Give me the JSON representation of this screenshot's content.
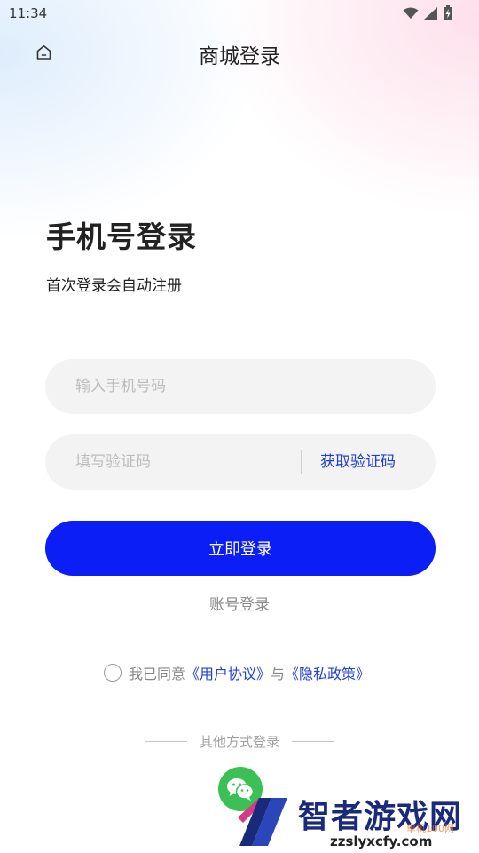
{
  "status_bar": {
    "time": "11:34",
    "icons": [
      "wifi-icon",
      "signal-icon",
      "battery-icon"
    ]
  },
  "header": {
    "title": "商城登录",
    "home_icon": "home-icon"
  },
  "login": {
    "title": "手机号登录",
    "subtitle": "首次登录会自动注册",
    "phone_placeholder": "输入手机号码",
    "code_placeholder": "填写验证码",
    "get_code_label": "获取验证码",
    "submit_label": "立即登录",
    "account_login_label": "账号登录"
  },
  "agreement": {
    "prefix": "我已同意",
    "user_agreement": "《用户协议》",
    "conjunction": "与",
    "privacy_policy": "《隐私政策》"
  },
  "other_login": {
    "label": "其他方式登录",
    "methods": [
      "wechat-icon"
    ]
  },
  "watermark": {
    "brand": "智者游戏网",
    "domain": "zzslyxcfy.com",
    "extra": "单机100网"
  },
  "colors": {
    "primary": "#0b1ef5",
    "link": "#1f3fd6",
    "wechat": "#3ac055"
  }
}
